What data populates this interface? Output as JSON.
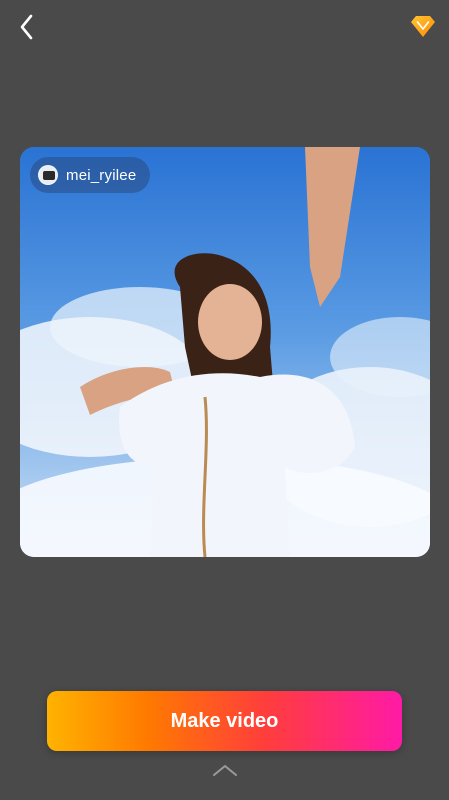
{
  "header": {
    "back_icon": "chevron-left-icon",
    "premium_icon": "diamond-icon",
    "colors": {
      "premium_start": "#FFC533",
      "premium_end": "#FF8A00"
    }
  },
  "preview": {
    "username": "mei_ryilee",
    "avatar_icon": "avatar-icon"
  },
  "actions": {
    "make_video_label": "Make video",
    "expand_icon": "chevron-up-icon",
    "gradient_colors": [
      "#ffb300",
      "#ff7a00",
      "#ff3d3d",
      "#ff1aa6"
    ]
  }
}
